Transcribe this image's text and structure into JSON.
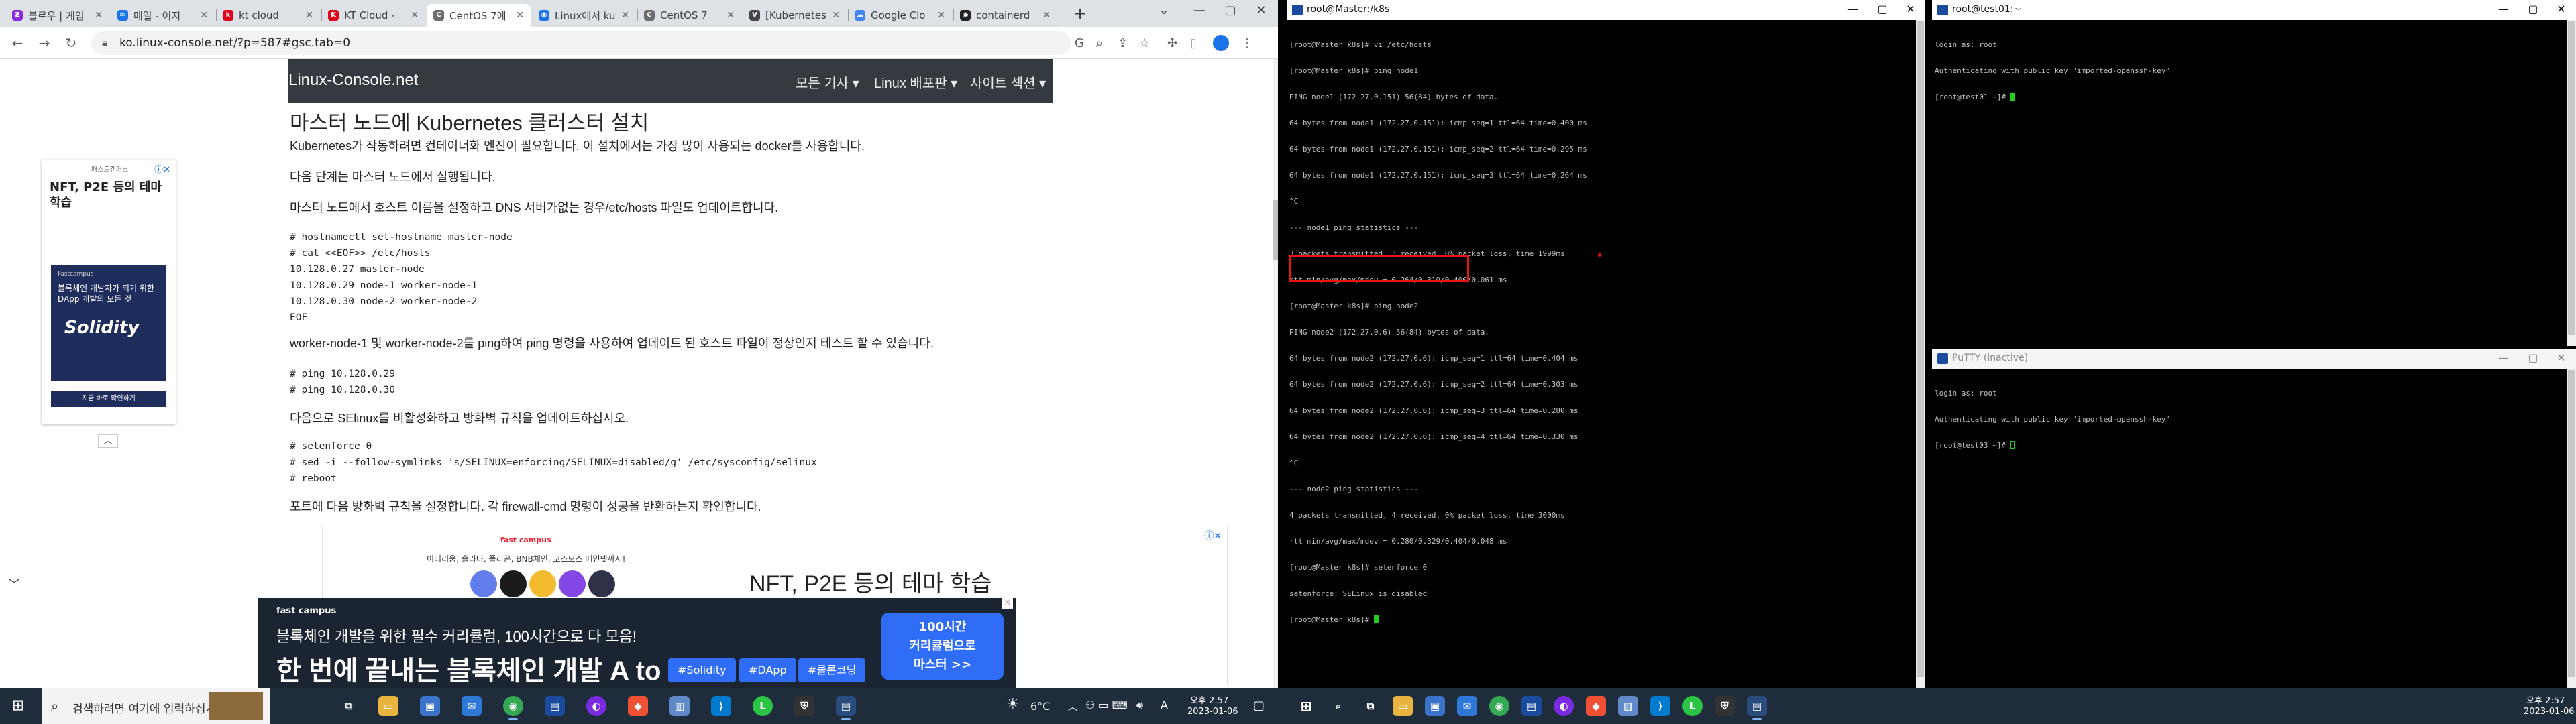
{
  "browser": {
    "tabs": [
      {
        "label": "블로우 | 게임",
        "fav_color": "#8a2be2",
        "fav_glyph": "Ƶ"
      },
      {
        "label": "메일 - 이지",
        "fav_color": "#1a73e8",
        "fav_glyph": "✉"
      },
      {
        "label": "kt cloud",
        "fav_color": "#e0001a",
        "fav_glyph": "k"
      },
      {
        "label": "KT Cloud -",
        "fav_color": "#e0001a",
        "fav_glyph": "K"
      },
      {
        "label": "CentOS 7에",
        "fav_color": "#6c6c6c",
        "fav_glyph": "C"
      },
      {
        "label": "Linux에서 ku",
        "fav_color": "#1a73e8",
        "fav_glyph": "◉"
      },
      {
        "label": "CentOS 7 ",
        "fav_color": "#6c6c6c",
        "fav_glyph": "C"
      },
      {
        "label": "[Kubernetes",
        "fav_color": "#444",
        "fav_glyph": "V"
      },
      {
        "label": "Google Clo",
        "fav_color": "#4285f4",
        "fav_glyph": "☁"
      },
      {
        "label": "containerd",
        "fav_color": "#222",
        "fav_glyph": "◉"
      }
    ],
    "active_tab": 4,
    "new_tab": "+",
    "url": "ko.linux-console.net/?p=587#gsc.tab=0",
    "window_controls": [
      "⌄",
      "—",
      "▢",
      "✕"
    ]
  },
  "site": {
    "brand": "Linux-Console.net",
    "menu": [
      "모든 기사 ▾",
      "Linux 배포판 ▾",
      "사이트 섹션 ▾"
    ]
  },
  "article": {
    "heading": "마스터 노드에 Kubernetes 클러스터 설치",
    "p1": "Kubernetes가 작동하려면 컨테이너화 엔진이 필요합니다. 이 설치에서는 가장 많이 사용되는 docker를 사용합니다.",
    "p2": "다음 단계는 마스터 노드에서 실행됩니다.",
    "p3": "마스터 노드에서 호스트 이름을 설정하고 DNS 서버가없는 경우/etc/hosts 파일도 업데이트합니다.",
    "code1": "# hostnamectl set-hostname master-node\n# cat <<EOF>> /etc/hosts\n10.128.0.27 master-node\n10.128.0.29 node-1 worker-node-1\n10.128.0.30 node-2 worker-node-2\nEOF",
    "p4": "worker-node-1 및 worker-node-2를 ping하여 ping 명령을 사용하여 업데이트 된 호스트 파일이 정상인지 테스트 할 수 있습니다.",
    "code2": "# ping 10.128.0.29\n# ping 10.128.0.30",
    "p5": "다음으로 SElinux를 비활성화하고 방화벽 규칙을 업데이트하십시오.",
    "code3": "# setenforce 0\n# sed -i --follow-symlinks 's/SELINUX=enforcing/SELINUX=disabled/g' /etc/sysconfig/selinux\n# reboot",
    "p6": "포트에 다음 방화벽 규칙을 설정합니다. 각 firewall-cmd 명령이 성공을 반환하는지 확인합니다."
  },
  "side_ad": {
    "small": "패스트캠퍼스",
    "title": "NFT, P2E 등의 테마 학습",
    "img_top": "Fastcampus",
    "img_sub": "블록체인 개발자가 되기 위한 DApp 개발의 모든 것",
    "img_big": "Solidity",
    "button": "지금 바로 확인하기"
  },
  "banner_ad": {
    "logo": "fast campus",
    "sub": "이더리움, 솔라나, 폴리곤, BNB체인, 코스모스 메인넷까지!",
    "headline": "NFT, P2E 등의 테마 학습",
    "coin_colors": [
      "#627eea",
      "#1b1b1b",
      "#f3ba2f",
      "#8247e5",
      "#2e3148"
    ]
  },
  "bottom_ad": {
    "brand": "fast campus",
    "line1": "블록체인 개발을 위한 필수 커리큘럼, 100시간으로 다 모음!",
    "line2": "한 번에 끝내는 블록체인 개발 A to Z",
    "tags": [
      "#Solidity",
      "#DApp",
      "#클론코딩"
    ],
    "cta": "100시간\n커리큘럼으로\n마스터 >>"
  },
  "terminals": {
    "master": {
      "title": "root@Master:/k8s",
      "lines": [
        "[root@Master k8s]# vi /etc/hosts",
        "[root@Master k8s]# ping node1",
        "PING node1 (172.27.0.151) 56(84) bytes of data.",
        "64 bytes from node1 (172.27.0.151): icmp_seq=1 ttl=64 time=0.400 ms",
        "64 bytes from node1 (172.27.0.151): icmp_seq=2 ttl=64 time=0.295 ms",
        "64 bytes from node1 (172.27.0.151): icmp_seq=3 ttl=64 time=0.264 ms",
        "^C",
        "--- node1 ping statistics ---",
        "3 packets transmitted, 3 received, 0% packet loss, time 1999ms",
        "rtt min/avg/max/mdev = 0.264/0.319/0.400/0.061 ms",
        "[root@Master k8s]# ping node2",
        "PING node2 (172.27.0.6) 56(84) bytes of data.",
        "64 bytes from node2 (172.27.0.6): icmp_seq=1 ttl=64 time=0.404 ms",
        "64 bytes from node2 (172.27.0.6): icmp_seq=2 ttl=64 time=0.303 ms",
        "64 bytes from node2 (172.27.0.6): icmp_seq=3 ttl=64 time=0.280 ms",
        "64 bytes from node2 (172.27.0.6): icmp_seq=4 ttl=64 time=0.330 ms",
        "^C",
        "--- node2 ping statistics ---",
        "4 packets transmitted, 4 received, 0% packet loss, time 3000ms",
        "rtt min/avg/max/mdev = 0.280/0.329/0.404/0.048 ms",
        "[root@Master k8s]# setenforce 0",
        "setenforce: SELinux is disabled",
        "[root@Master k8s]# "
      ]
    },
    "test01": {
      "title": "root@test01:~",
      "lines": [
        "login as: root",
        "Authenticating with public key \"imported-openssh-key\"",
        "[root@test01 ~]# "
      ]
    },
    "test03": {
      "title": "PuTTY (inactive)",
      "lines": [
        "login as: root",
        "Authenticating with public key \"imported-openssh-key\"",
        "[root@test03 ~]# "
      ]
    },
    "window_controls": [
      "—",
      "▢",
      "✕"
    ]
  },
  "taskbar_left": {
    "search_placeholder": "검색하려면 여기에 입력하십시오",
    "weather": "6°C",
    "ime": "A",
    "time": "오후 2:57",
    "date": "2023-01-06"
  },
  "taskbar_right": {
    "time": "오후 2:57",
    "date": "2023-01-06"
  }
}
